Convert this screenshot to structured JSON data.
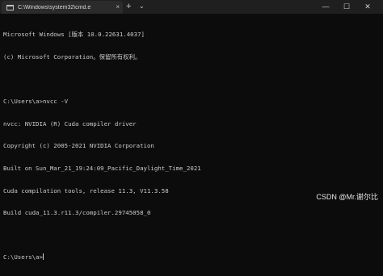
{
  "titlebar": {
    "tab_title": "C:\\Windows\\system32\\cmd.e",
    "tab_close": "×",
    "new_tab": "+",
    "dropdown": "⌄",
    "minimize": "—",
    "maximize": "☐",
    "close": "✕"
  },
  "terminal": {
    "lines": [
      "Microsoft Windows [版本 10.0.22631.4037]",
      "(c) Microsoft Corporation。保留所有权利。",
      "",
      "C:\\Users\\a>nvcc -V",
      "nvcc: NVIDIA (R) Cuda compiler driver",
      "Copyright (c) 2005-2021 NVIDIA Corporation",
      "Built on Sun_Mar_21_19:24:09_Pacific_Daylight_Time_2021",
      "Cuda compilation tools, release 11.3, V11.3.58",
      "Build cuda_11.3.r11.3/compiler.29745058_0",
      "",
      "C:\\Users\\a>"
    ]
  },
  "watermark": "CSDN @Mr.谢尔比"
}
